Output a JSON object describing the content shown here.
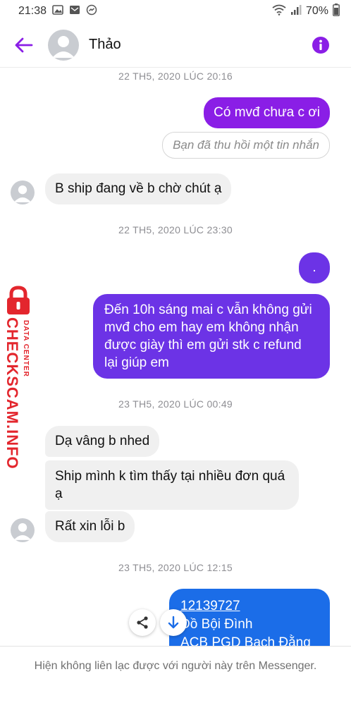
{
  "status_bar": {
    "time": "21:38",
    "battery": "70%"
  },
  "header": {
    "contact_name": "Thảo"
  },
  "chat": {
    "timestamps": [
      "22 TH5, 2020 LÚC 20:16",
      "22 TH5, 2020 LÚC 23:30",
      "23 TH5, 2020 LÚC 00:49",
      "23 TH5, 2020 LÚC 12:15"
    ],
    "messages": [
      "Có mvđ chưa c ơi",
      "Bạn đã thu hồi một tin nhắn",
      "B ship đang về b chờ chút ạ",
      ".",
      "Đến 10h sáng mai c vẫn không gửi mvđ cho em hay em không nhận được giày thì em gửi stk c refund lại giúp em",
      "Dạ vâng b nhed",
      "Ship mình k tìm thấy tại nhiều đơn quá ạ",
      "Rất xin lỗi b"
    ],
    "last_message_lines": [
      "12139727",
      "Đồ Bội Đình",
      "ACB PGD Bạch Đằng"
    ]
  },
  "footer": {
    "notice": "Hiện không liên lạc được với người này trên Messenger."
  },
  "watermark": {
    "brand": "CHECKSCAM.INFO",
    "tag": "DATA CENTER"
  },
  "colors": {
    "accent_purple": "#8a1ee6",
    "accent_violet": "#6c33e6",
    "accent_blue": "#1b6de8",
    "incoming_bg": "#f0f0f0",
    "watermark_red": "#e3262d"
  },
  "icons": [
    "back-arrow-icon",
    "info-icon",
    "share-icon",
    "scroll-down-icon",
    "avatar-placeholder-icon"
  ]
}
